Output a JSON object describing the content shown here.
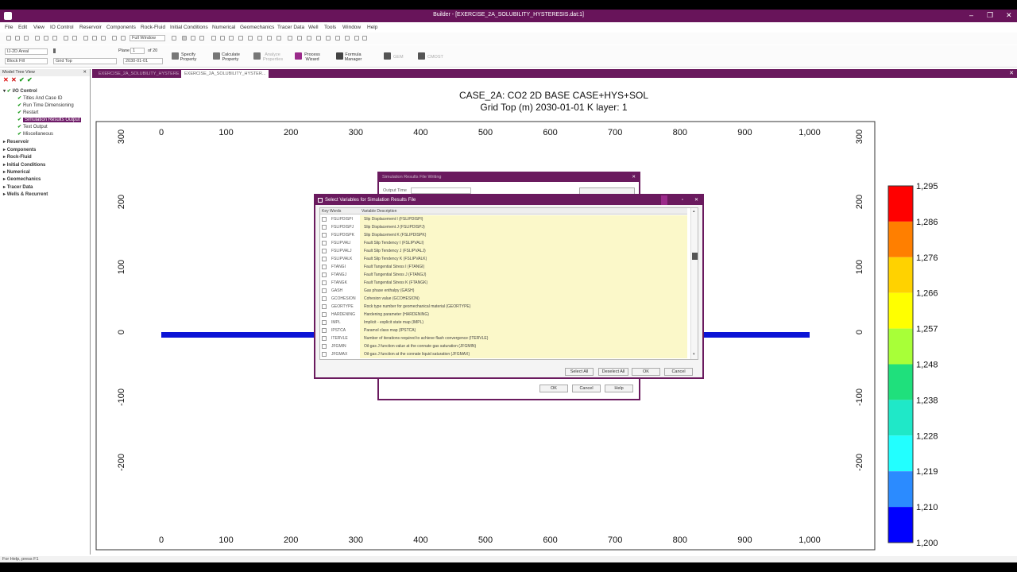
{
  "window": {
    "title": "Builder - [EXERCISE_2A_SOLUBILITY_HYSTERESIS.dat:1]",
    "min": "–",
    "max": "❐",
    "close": "✕"
  },
  "menu": [
    "File",
    "Edit",
    "View",
    "IO Control",
    "Reservoir",
    "Components",
    "Rock-Fluid",
    "Initial Conditions",
    "Numerical",
    "Geomechanics",
    "Tracer Data",
    "Well",
    "Tools",
    "Window",
    "Help"
  ],
  "toolbar": {
    "window_select": "Full Window",
    "view_select": "IJ-2D Areal",
    "plane_label": "Plane",
    "plane_value": "1",
    "plane_of": "of 20",
    "fill_select": "Block Fill",
    "property_select": "Grid Top",
    "date_select": "2030-01-01",
    "buttons": [
      {
        "label": "Specify\nProperty"
      },
      {
        "label": "Calculate\nProperty"
      },
      {
        "label": "Analyze\nProperties"
      },
      {
        "label": "Process\nWizard"
      },
      {
        "label": "Formula\nManager"
      },
      {
        "label": "GEM"
      },
      {
        "label": "CMOST"
      }
    ]
  },
  "model_tree": {
    "title": "Model Tree View",
    "items": [
      {
        "label": "I/O Control",
        "level": 0,
        "bold": true
      },
      {
        "label": "Titles And Case ID",
        "level": 1
      },
      {
        "label": "Run Time Dimensioning",
        "level": 1
      },
      {
        "label": "Restart",
        "level": 1
      },
      {
        "label": "Simulation Results Output",
        "level": 1,
        "selected": true
      },
      {
        "label": "Text Output",
        "level": 1
      },
      {
        "label": "Miscellaneous",
        "level": 1
      },
      {
        "label": "Reservoir",
        "level": 0,
        "bold": true
      },
      {
        "label": "Components",
        "level": 0,
        "bold": true
      },
      {
        "label": "Rock-Fluid",
        "level": 0,
        "bold": true
      },
      {
        "label": "Initial Conditions",
        "level": 0,
        "bold": true
      },
      {
        "label": "Numerical",
        "level": 0,
        "bold": true
      },
      {
        "label": "Geomechanics",
        "level": 0,
        "bold": true
      },
      {
        "label": "Tracer Data",
        "level": 0,
        "bold": true
      },
      {
        "label": "Wells & Recurrent",
        "level": 0,
        "bold": true
      }
    ]
  },
  "tabs": [
    {
      "label": "EXERCISE_2A_SOLUBILITY_HYSTERE"
    },
    {
      "label": "EXERCISE_2A_SOLUBILITY_HYSTER..."
    }
  ],
  "plot": {
    "title": "CASE_2A: CO2 2D BASE CASE+HYS+SOL",
    "subtitle": "Grid Top (m) 2030-01-01     K layer: 1",
    "x_ticks": [
      "0",
      "100",
      "200",
      "300",
      "400",
      "500",
      "600",
      "700",
      "800",
      "900",
      "1,000"
    ],
    "y_ticks": [
      "300",
      "200",
      "100",
      "0",
      "-100",
      "-200"
    ],
    "colorbar": [
      "1,295",
      "1,286",
      "1,276",
      "1,266",
      "1,257",
      "1,248",
      "1,238",
      "1,228",
      "1,219",
      "1,210",
      "1,200"
    ],
    "colors": [
      "#ff0000",
      "#ff7f00",
      "#ffd200",
      "#ffff00",
      "#a8ff38",
      "#33e633",
      "#1fe07c",
      "#1fe8c8",
      "#22ffff",
      "#2b8bff",
      "#0000ff"
    ],
    "grid_color": "#0b14d6"
  },
  "dialog_back": {
    "title": "Simulation Results File Writing",
    "output_label": "Output Time",
    "ok": "OK",
    "cancel": "Cancel",
    "help": "Help"
  },
  "dialog": {
    "title": "Select Variables for Simulation Results File",
    "col_key": "Key Words",
    "col_desc": "Variable Description",
    "rows": [
      {
        "k": "FSLIPDISPI",
        "d": "Slip Displacement I (FSLIPDISPI)"
      },
      {
        "k": "FSLIPDISPJ",
        "d": "Slip Displacement J (FSLIPDISPJ)"
      },
      {
        "k": "FSLIPDISPK",
        "d": "Slip Displacement K (FSLIPDISPK)"
      },
      {
        "k": "FSLIPVALI",
        "d": "Fault Slip Tendency I (FSLIPVALI)"
      },
      {
        "k": "FSLIPVALJ",
        "d": "Fault Slip Tendency J (FSLIPVALJ)"
      },
      {
        "k": "FSLIPVALK",
        "d": "Fault Slip Tendency K (FSLIPVALK)"
      },
      {
        "k": "FTANGI",
        "d": "Fault Tangential Stress I (FTANGI)"
      },
      {
        "k": "FTANGJ",
        "d": "Fault Tangential Stress J (FTANGJ)"
      },
      {
        "k": "FTANGK",
        "d": "Fault Tangential Stress K (FTANGK)"
      },
      {
        "k": "GASH",
        "d": "Gas phase enthalpy (GASH)"
      },
      {
        "k": "GCOHESION",
        "d": "Cohesion value (GCOHESION)"
      },
      {
        "k": "GEORTYPE",
        "d": "Rock type number for geomechanical material (GEORTYPE)"
      },
      {
        "k": "HARDENING",
        "d": "Hardening parameter (HARDENING)"
      },
      {
        "k": "IMPL",
        "d": "Implicit - explicit state map (IMPL)"
      },
      {
        "k": "IPSTCA",
        "d": "Paramol class map (IPSTCA)"
      },
      {
        "k": "ITERVLE",
        "d": "Number of iterations required to achieve flash convergence (ITERVLE)"
      },
      {
        "k": "JFGMIN",
        "d": "Oil-gas J function value at the connate gas saturation (JFGMIN)"
      },
      {
        "k": "JFGMAX",
        "d": "Oil-gas J function at the connate liquid saturation (JFGMAX)"
      }
    ],
    "select_all": "Select All",
    "deselect_all": "Deselect All",
    "ok": "OK",
    "cancel": "Cancel"
  },
  "status": "For Help, press F1"
}
